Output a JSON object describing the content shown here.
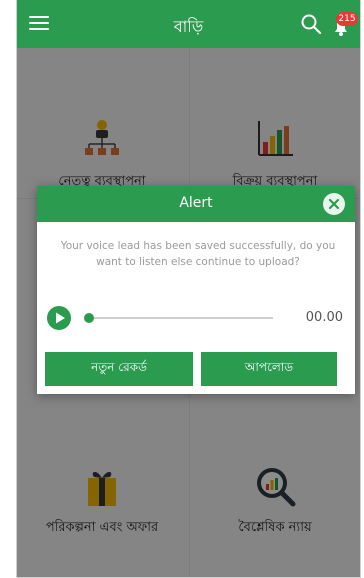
{
  "header": {
    "title": "বাড়ি",
    "badge_count": "215"
  },
  "tiles": [
    {
      "label": "নেতৃত্ব ব্যবস্থাপনা",
      "icon": "leadership-org-icon"
    },
    {
      "label": "বিক্রয় ব্যবস্থাপনা",
      "icon": "sales-chart-icon"
    },
    {
      "label": "পরিকল্পনা এবং অফার",
      "icon": "gift-icon"
    },
    {
      "label": "বৈশ্লেষিক ন্যায়",
      "icon": "analytics-magnifier-icon"
    }
  ],
  "dialog": {
    "title": "Alert",
    "message": "Your voice lead has been saved successfully, do you want to listen else continue to upload?",
    "time": "00.00",
    "progress": 0,
    "new_record_label": "নতুন রেকর্ড",
    "upload_label": "আপলোড"
  },
  "colors": {
    "primary": "#2b9b50",
    "badge": "#e53935",
    "overlay": "#000000"
  }
}
